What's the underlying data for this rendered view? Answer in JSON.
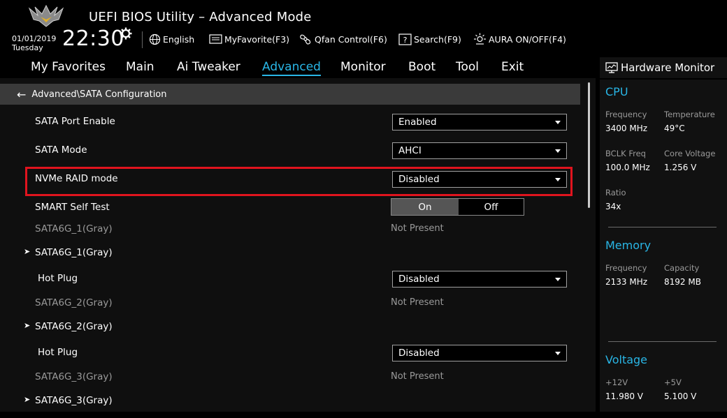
{
  "header": {
    "title": "UEFI BIOS Utility – Advanced Mode",
    "date": "01/01/2019",
    "day": "Tuesday",
    "time": "22:30",
    "buttons": [
      {
        "label": "English",
        "icon": "globe-icon"
      },
      {
        "label": "MyFavorite(F3)",
        "icon": "favorite-icon"
      },
      {
        "label": "Qfan Control(F6)",
        "icon": "fan-icon"
      },
      {
        "label": "Search(F9)",
        "icon": "search-help-icon"
      },
      {
        "label": "AURA ON/OFF(F4)",
        "icon": "aura-icon"
      }
    ]
  },
  "nav": {
    "items": [
      "My Favorites",
      "Main",
      "Ai Tweaker",
      "Advanced",
      "Monitor",
      "Boot",
      "Tool",
      "Exit"
    ],
    "active": "Advanced"
  },
  "breadcrumb": "Advanced\\SATA Configuration",
  "settings": {
    "sata_port_enable": {
      "label": "SATA Port Enable",
      "value": "Enabled"
    },
    "sata_mode": {
      "label": "SATA Mode",
      "value": "AHCI"
    },
    "nvme_raid_mode": {
      "label": "NVMe RAID mode",
      "value": "Disabled"
    },
    "smart_self_test": {
      "label": "SMART Self Test",
      "on": "On",
      "off": "Off",
      "selected": "On"
    },
    "sata1_gray": {
      "label": "SATA6G_1(Gray)",
      "value": "Not Present"
    },
    "sata1_sub": {
      "label": "SATA6G_1(Gray)"
    },
    "hot_plug_1": {
      "label": "Hot Plug",
      "value": "Disabled"
    },
    "sata2_gray": {
      "label": "SATA6G_2(Gray)",
      "value": "Not Present"
    },
    "sata2_sub": {
      "label": "SATA6G_2(Gray)"
    },
    "hot_plug_2": {
      "label": "Hot Plug",
      "value": "Disabled"
    },
    "sata3_gray": {
      "label": "SATA6G_3(Gray)",
      "value": "Not Present"
    },
    "sata3_sub": {
      "label": "SATA6G_3(Gray)"
    }
  },
  "hardware_monitor": {
    "title": "Hardware Monitor",
    "cpu": {
      "heading": "CPU",
      "frequency": {
        "label": "Frequency",
        "value": "3400 MHz"
      },
      "temperature": {
        "label": "Temperature",
        "value": "49°C"
      },
      "bclk": {
        "label": "BCLK Freq",
        "value": "100.0 MHz"
      },
      "core_voltage": {
        "label": "Core Voltage",
        "value": "1.256 V"
      },
      "ratio": {
        "label": "Ratio",
        "value": "34x"
      }
    },
    "memory": {
      "heading": "Memory",
      "frequency": {
        "label": "Frequency",
        "value": "2133 MHz"
      },
      "capacity": {
        "label": "Capacity",
        "value": "8192 MB"
      }
    },
    "voltage": {
      "heading": "Voltage",
      "v12": {
        "label": "+12V",
        "value": "11.980 V"
      },
      "v5": {
        "label": "+5V",
        "value": "5.100 V"
      }
    }
  },
  "colors": {
    "accent": "#29b6e6",
    "highlight_border": "#e0141e",
    "breadcrumb_bg": "#3a3a3a",
    "panel_bg": "#111111"
  }
}
